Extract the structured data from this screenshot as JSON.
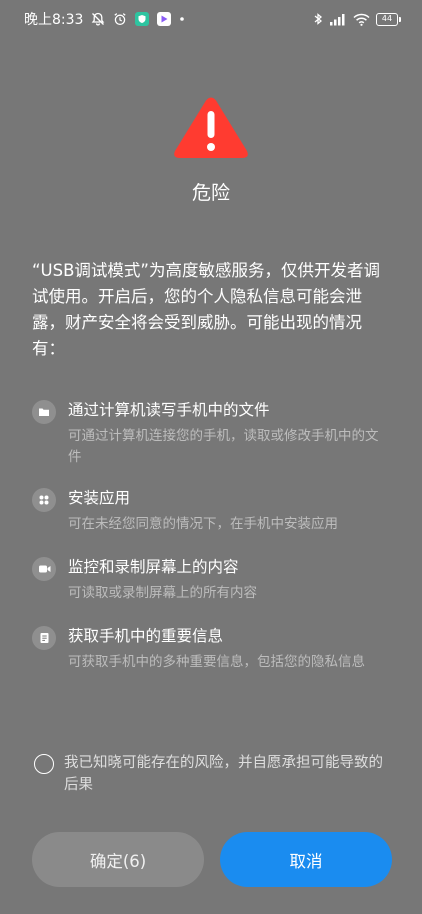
{
  "status_bar": {
    "time": "晚上8:33",
    "icons": [
      "bell-off-icon",
      "alarm-icon",
      "app-shield-icon",
      "app-play-icon",
      "dot-icon"
    ],
    "right_icons": [
      "bluetooth-icon",
      "signal-icon",
      "wifi-icon",
      "battery-icon"
    ],
    "battery_level": "44"
  },
  "dialog": {
    "warning_icon": "warning-triangle-icon",
    "warning_color": "#ff3b30",
    "title": "危险",
    "intro": "“USB调试模式”为高度敏感服务，仅供开发者调试使用。开启后，您的个人隐私信息可能会泄露，财产安全将会受到威胁。可能出现的情况有：",
    "permissions": [
      {
        "icon": "folder-icon",
        "title": "通过计算机读写手机中的文件",
        "desc": "可通过计算机连接您的手机，读取或修改手机中的文件"
      },
      {
        "icon": "apps-icon",
        "title": "安装应用",
        "desc": "可在未经您同意的情况下，在手机中安装应用"
      },
      {
        "icon": "video-icon",
        "title": "监控和录制屏幕上的内容",
        "desc": "可读取或录制屏幕上的所有内容"
      },
      {
        "icon": "document-icon",
        "title": "获取手机中的重要信息",
        "desc": "可获取手机中的多种重要信息，包括您的隐私信息"
      }
    ],
    "consent_text": "我已知晓可能存在的风险，并自愿承担可能导致的后果",
    "confirm_label": "确定(6)",
    "cancel_label": "取消",
    "accent_color": "#1a8cf0"
  }
}
